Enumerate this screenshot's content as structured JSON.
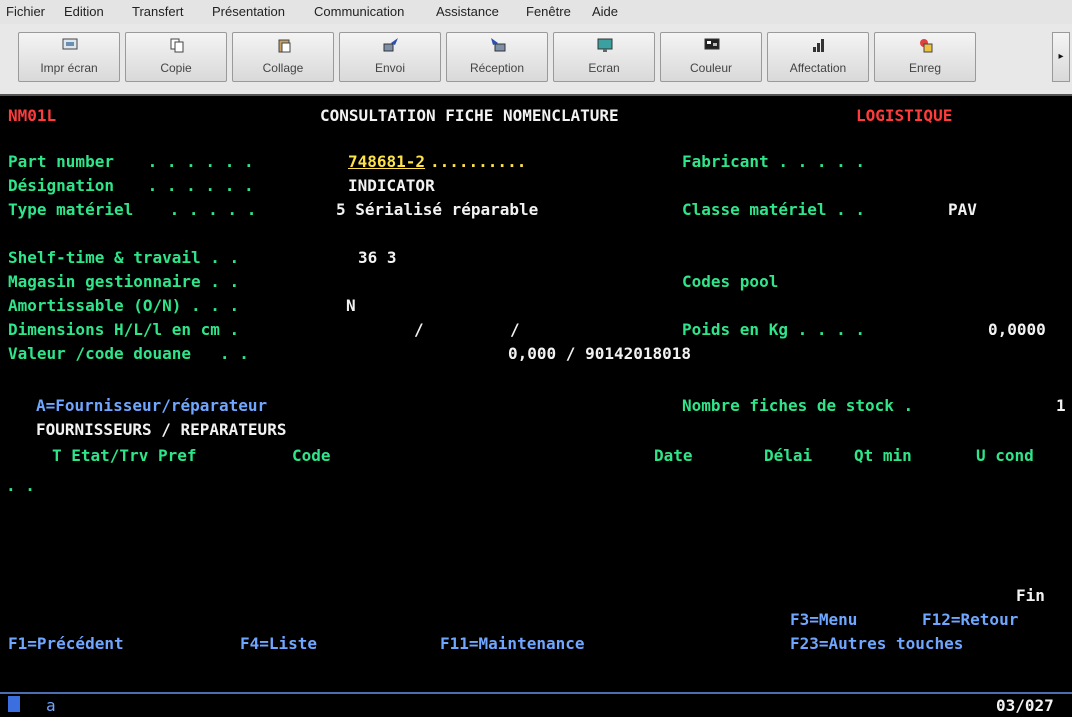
{
  "menubar": {
    "items": [
      "Fichier",
      "Edition",
      "Transfert",
      "Présentation",
      "Communication",
      "Assistance",
      "Fenêtre",
      "Aide"
    ]
  },
  "toolbar": {
    "buttons": [
      {
        "label": "Impr écran",
        "icon": "printer-screen-icon"
      },
      {
        "label": "Copie",
        "icon": "copy-icon"
      },
      {
        "label": "Collage",
        "icon": "paste-icon"
      },
      {
        "label": "Envoi",
        "icon": "send-icon"
      },
      {
        "label": "Réception",
        "icon": "receive-icon"
      },
      {
        "label": "Ecran",
        "icon": "screen-icon"
      },
      {
        "label": "Couleur",
        "icon": "color-icon"
      },
      {
        "label": "Affectation",
        "icon": "assign-icon"
      },
      {
        "label": "Enreg",
        "icon": "record-icon"
      }
    ],
    "more_arrow": "▸"
  },
  "terminal": {
    "program_id": "NM01L",
    "screen_title": "CONSULTATION FICHE NOMENCLATURE",
    "module": "LOGISTIQUE",
    "fields": {
      "part_number_label": "Part number",
      "part_number_dots": " . . . . . .",
      "part_number_value": "748681-2",
      "part_number_fill": "..........",
      "fabricant_label": "Fabricant . . . . .",
      "designation_label": "Désignation",
      "designation_dots": " . . . . . .",
      "designation_value": "INDICATOR",
      "type_label": "Type matériel",
      "type_dots": " . . . . .",
      "type_value": "5 Sérialisé réparable",
      "classe_label": "Classe matériel . .",
      "classe_value": "PAV",
      "shelf_label": "Shelf-time & travail . .",
      "shelf_value": "36 3",
      "magasin_label": "Magasin gestionnaire . .",
      "codes_pool_label": "Codes pool",
      "amort_label": "Amortissable (O/N) . . .",
      "amort_value": "N",
      "dimensions_label": "Dimensions H/L/l en cm .",
      "dimensions_sep1": "/",
      "dimensions_sep2": "/",
      "poids_label": "Poids en Kg . . . .",
      "poids_value": "0,0000",
      "valeur_label": "Valeur /code douane   . .",
      "valeur_value": "0,000 / 90142018018",
      "option_label": "A=Fournisseur/réparateur",
      "stock_label": "Nombre fiches de stock .",
      "stock_value": "1",
      "section_title": "FOURNISSEURS / REPARATEURS",
      "col_t": "T Etat/Trv Pref",
      "col_code": "Code",
      "col_date": "Date",
      "col_delai": "Délai",
      "col_qtmin": "Qt min",
      "col_ucond": "U cond",
      "row_marker": ". .",
      "fin": "Fin"
    },
    "function_keys": {
      "f3": "F3=Menu",
      "f12": "F12=Retour",
      "f1": "F1=Précédent",
      "f4": "F4=Liste",
      "f11": "F11=Maintenance",
      "f23": "F23=Autres touches"
    }
  },
  "statusbar": {
    "session": "a",
    "cursor_pos": "03/027"
  }
}
